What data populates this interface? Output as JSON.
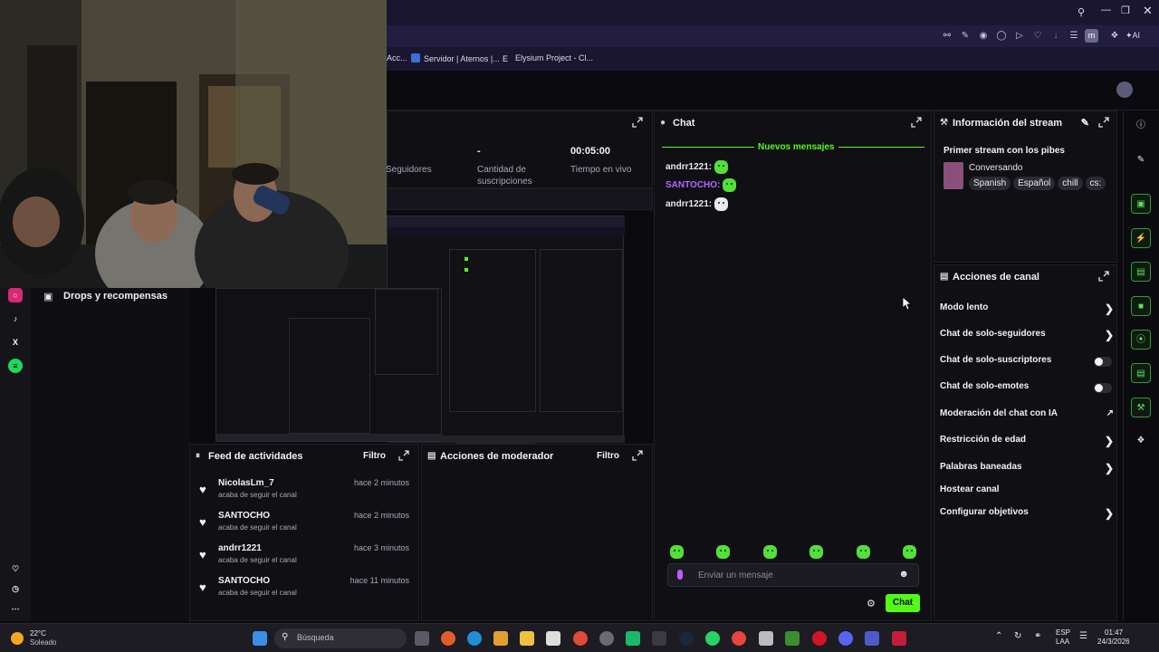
{
  "browser": {
    "toolbar_profile": "m",
    "toolbar_ai": "AI"
  },
  "bookmarks": [
    {
      "label": "Acc..."
    },
    {
      "label": "Servidor | Aternos |..."
    },
    {
      "label": "Elysium Project - Cl..."
    }
  ],
  "stats": {
    "followers_label": "Seguidores",
    "subs_value": "-",
    "subs_label_1": "Cantidad de",
    "subs_label_2": "suscripciones",
    "time_value": "00:05:00",
    "time_label": "Tiempo en vivo"
  },
  "left_sidebar": {
    "drops_label": "Drops y recompensas"
  },
  "feed": {
    "title": "Feed de actividades",
    "filter": "Filtro",
    "items": [
      {
        "name": "NicolasLm_7",
        "sub": "acaba de seguir el canal",
        "time": "hace 2 minutos"
      },
      {
        "name": "SANTOCHO",
        "sub": "acaba de seguir el canal",
        "time": "hace 2 minutos"
      },
      {
        "name": "andrr1221",
        "sub": "acaba de seguir el canal",
        "time": "hace 3 minutos"
      },
      {
        "name": "SANTOCHO",
        "sub": "acaba de seguir el canal",
        "time": "hace 11 minutos"
      }
    ]
  },
  "mod_actions": {
    "title": "Acciones de moderador",
    "filter": "Filtro"
  },
  "chat": {
    "title": "Chat",
    "new_messages": "Nuevos mensajes",
    "messages": [
      {
        "user": "andrr1221:",
        "color": "#e8e8ee"
      },
      {
        "user": "SANTOCHO:",
        "color": "#b865ff"
      },
      {
        "user": "andrr1221:",
        "color": "#e8e8ee"
      }
    ],
    "input_placeholder": "Enviar un mensaje",
    "send_label": "Chat",
    "accent": "#53fc18"
  },
  "stream_info": {
    "title": "Información del stream",
    "stream_title": "Primer stream con los pibes",
    "category": "Conversando",
    "tags": [
      "Spanish",
      "Español",
      "chill",
      "cs:"
    ]
  },
  "channel_actions": {
    "title": "Acciones de canal",
    "items": [
      {
        "label": "Modo lento",
        "control": "chevron"
      },
      {
        "label": "Chat de solo-seguidores",
        "control": "chevron"
      },
      {
        "label": "Chat de solo-suscriptores",
        "control": "toggle"
      },
      {
        "label": "Chat de solo-emotes",
        "control": "toggle"
      },
      {
        "label": "Moderación del chat con IA",
        "control": "external"
      },
      {
        "label": "Restricción de edad",
        "control": "chevron"
      },
      {
        "label": "Palabras baneadas",
        "control": "chevron"
      },
      {
        "label": "Hostear canal",
        "control": "none"
      },
      {
        "label": "Configurar objetivos",
        "control": "chevron"
      }
    ]
  },
  "taskbar": {
    "weather_temp": "22°C",
    "weather_desc": "Soleado",
    "search_placeholder": "Búsqueda",
    "lang_1": "ESP",
    "lang_2": "LAA",
    "time": "01:47",
    "date": "24/3/2026"
  }
}
